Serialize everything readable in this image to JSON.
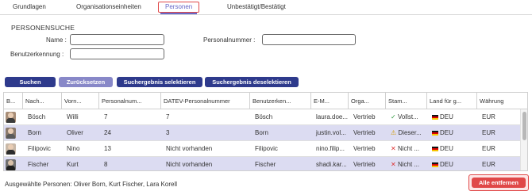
{
  "tabs": [
    "Grundlagen",
    "Organisationseinheiten",
    "Personen",
    "Unbestätigt/Bestätigt"
  ],
  "search": {
    "title": "PERSONENSUCHE",
    "name_label": "Name :",
    "personalnummer_label": "Personalnummer :",
    "benutzerkennung_label": "Benutzerkennung :",
    "name_value": "",
    "personalnummer_value": "",
    "benutzerkennung_value": ""
  },
  "buttons": {
    "suchen": "Suchen",
    "zuruecksetzen": "Zurücksetzen",
    "selektieren": "Suchergebnis selektieren",
    "deselektieren": "Suchergebnis deselektieren",
    "alle_entfernen": "Alle entfernen"
  },
  "columns": [
    "B...",
    "Nach...",
    "Vorn...",
    "Personalnum...",
    "DATEV-Personalnummer",
    "Benutzerken...",
    "E-M...",
    "Orga...",
    "Stam...",
    "Land für g...",
    "Währung"
  ],
  "rows": [
    {
      "nachname": "Bösch",
      "vorname": "Willi",
      "personalnummer": "7",
      "datev": "7",
      "benutzer": "Bösch",
      "email": "laura.doe...",
      "orga": "Vertrieb",
      "status_icon": "✓",
      "status": "Vollst...",
      "status_kind": "ok",
      "land": "DEU",
      "waehrung": "EUR",
      "selected": false
    },
    {
      "nachname": "Born",
      "vorname": "Oliver",
      "personalnummer": "24",
      "datev": "3",
      "benutzer": "Born",
      "email": "justin.vol...",
      "orga": "Vertrieb",
      "status_icon": "⚠",
      "status": "Dieser...",
      "status_kind": "warn",
      "land": "DEU",
      "waehrung": "EUR",
      "selected": true
    },
    {
      "nachname": "Filipovic",
      "vorname": "Nino",
      "personalnummer": "13",
      "datev": "Nicht vorhanden",
      "benutzer": "Filipovic",
      "email": "nino.filip...",
      "orga": "Vertrieb",
      "status_icon": "✕",
      "status": "Nicht ...",
      "status_kind": "err",
      "land": "DEU",
      "waehrung": "EUR",
      "selected": false
    },
    {
      "nachname": "Fischer",
      "vorname": "Kurt",
      "personalnummer": "8",
      "datev": "Nicht vorhanden",
      "benutzer": "Fischer",
      "email": "shadi.kar...",
      "orga": "Vertrieb",
      "status_icon": "✕",
      "status": "Nicht ...",
      "status_kind": "err",
      "land": "DEU",
      "waehrung": "EUR",
      "selected": true
    }
  ],
  "selected_persons": "Ausgewählte Personen: Oliver Born, Kurt Fischer, Lara Korell"
}
